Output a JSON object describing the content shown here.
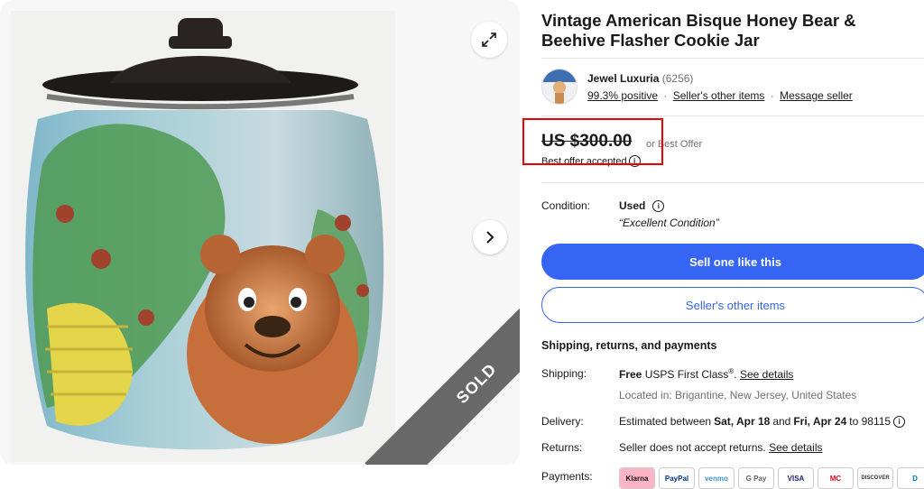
{
  "listing": {
    "title": "Vintage American Bisque Honey Bear & Beehive Flasher Cookie Jar",
    "sold_badge": "SOLD"
  },
  "seller": {
    "name": "Jewel Luxuria",
    "feedback_count": "(6256)",
    "positive": "99.3% positive",
    "other_items_link": "Seller's other items",
    "message_link": "Message seller",
    "separator": "·"
  },
  "price": {
    "amount": "US $300.00",
    "or_best_offer": "or Best Offer",
    "offer_status": "Best offer accepted",
    "info_glyph": "i"
  },
  "condition": {
    "label": "Condition:",
    "value": "Used",
    "info_glyph": "i",
    "note": "“Excellent Condition”"
  },
  "buttons": {
    "sell_one": "Sell one like this",
    "other_items": "Seller's other items"
  },
  "shipping": {
    "section_title": "Shipping, returns, and payments",
    "shipping_label": "Shipping:",
    "shipping_free": "Free",
    "shipping_method": "USPS First Class",
    "registered_mark": "®",
    "shipping_sep": ".",
    "see_details": "See details",
    "location": "Located in: Brigantine, New Jersey, United States",
    "delivery_label": "Delivery:",
    "delivery_prefix": "Estimated between",
    "delivery_start": "Sat, Apr 18",
    "delivery_and": "and",
    "delivery_end": "Fri, Apr 24",
    "delivery_to": "to 98115",
    "returns_label": "Returns:",
    "returns_text": "Seller does not accept returns.",
    "returns_details": "See details",
    "payments_label": "Payments:",
    "payment_methods": [
      "Klarna",
      "PayPal",
      "venmo",
      "G Pay",
      "VISA",
      "MC",
      "DISCOVER",
      "D"
    ]
  },
  "icons": {
    "expand": "expand-icon",
    "next": "chevron-right-icon",
    "info": "info-icon"
  },
  "colors": {
    "accent": "#3665f3",
    "sold_ribbon": "#686868",
    "highlight": "#ee0000"
  }
}
